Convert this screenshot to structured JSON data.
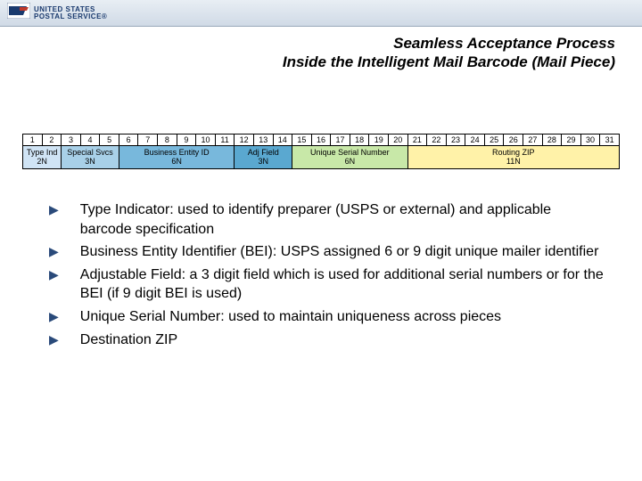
{
  "logo": {
    "line1": "UNITED STATES",
    "line2": "POSTAL SERVICE®"
  },
  "title": {
    "line1": "Seamless Acceptance Process",
    "line2": "Inside the Intelligent Mail Barcode (Mail Piece)"
  },
  "positions": [
    "1",
    "2",
    "3",
    "4",
    "5",
    "6",
    "7",
    "8",
    "9",
    "10",
    "11",
    "12",
    "13",
    "14",
    "15",
    "16",
    "17",
    "18",
    "19",
    "20",
    "21",
    "22",
    "23",
    "24",
    "25",
    "26",
    "27",
    "28",
    "29",
    "30",
    "31"
  ],
  "fields": {
    "typeInd": "Type Ind\n2N",
    "specialSvcs": "Special Svcs\n3N",
    "bei": "Business Entity ID\n6N",
    "adj": "Adj Field\n3N",
    "usn": "Unique Serial Number\n6N",
    "routing": "Routing ZIP\n11N"
  },
  "bullets": [
    "Type Indicator: used to identify preparer (USPS or external) and applicable barcode specification",
    "Business Entity Identifier (BEI):  USPS assigned 6 or 9 digit unique mailer identifier",
    "Adjustable Field:  a 3 digit field which is used for additional serial numbers or for the BEI (if 9 digit BEI is used)",
    "Unique Serial Number: used to maintain uniqueness across pieces",
    "Destination ZIP"
  ]
}
